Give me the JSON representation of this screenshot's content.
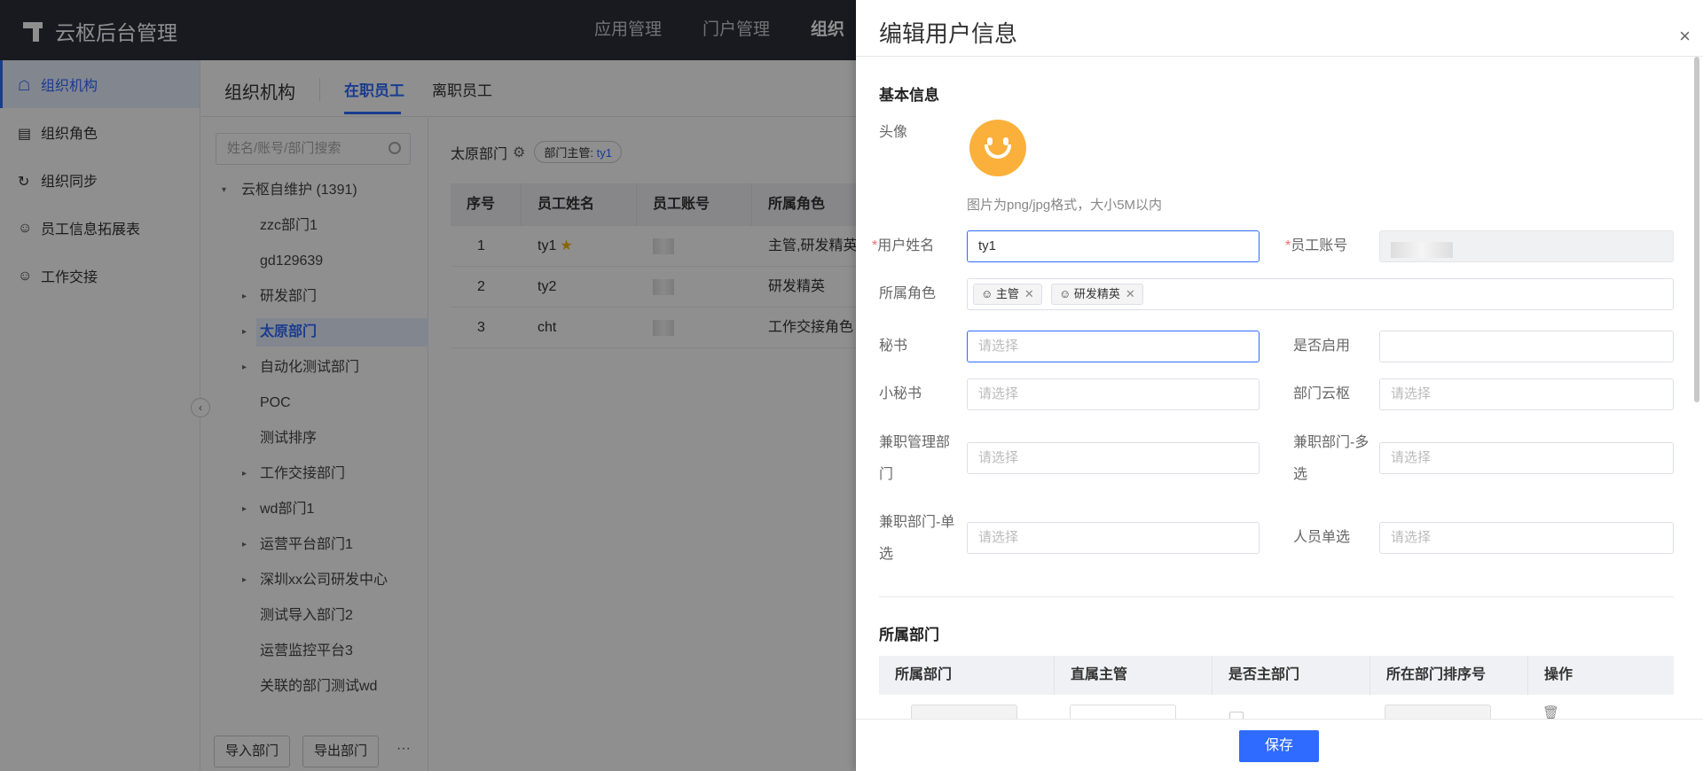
{
  "app": {
    "title": "云枢后台管理"
  },
  "topnav": {
    "items": [
      "应用管理",
      "门户管理",
      "组织"
    ]
  },
  "sidebar": {
    "items": [
      "组织机构",
      "组织角色",
      "组织同步",
      "员工信息拓展表",
      "工作交接"
    ]
  },
  "content": {
    "title": "组织机构",
    "tabs": [
      "在职员工",
      "离职员工"
    ]
  },
  "tree": {
    "search_placeholder": "姓名/账号/部门搜索",
    "root": "云枢自维护 (1391)",
    "nodes": [
      "zzc部门1",
      "gd129639",
      "研发部门",
      "太原部门",
      "自动化测试部门",
      "POC",
      "测试排序",
      "工作交接部门",
      "wd部门1",
      "运营平台部门1",
      "深圳xx公司研发中心",
      "测试导入部门2",
      "运营监控平台3",
      "关联的部门测试wd"
    ],
    "import_btn": "导入部门",
    "export_btn": "导出部门",
    "more": "···"
  },
  "employees": {
    "dept": "太原部门",
    "manager_label": "部门主管:",
    "manager_name": "ty1",
    "headers": [
      "序号",
      "员工姓名",
      "员工账号",
      "所属角色"
    ],
    "rows": [
      {
        "no": "1",
        "name": "ty1",
        "role": "主管,研发精英"
      },
      {
        "no": "2",
        "name": "ty2",
        "role": "研发精英"
      },
      {
        "no": "3",
        "name": "cht",
        "role": "工作交接角色"
      }
    ]
  },
  "drawer": {
    "title": "编辑用户信息",
    "close": "×",
    "basic_section": "基本信息",
    "avatar_label": "头像",
    "avatar_hint": "图片为png/jpg格式，大小5M以内",
    "name_label": "用户姓名",
    "name_value": "ty1",
    "account_label": "员工账号",
    "roles_label": "所属角色",
    "roles": [
      "主管",
      "研发精英"
    ],
    "secretary_label": "秘书",
    "enabled_label": "是否启用",
    "small_secretary_label": "小秘书",
    "dept_yunshu_label": "部门云枢",
    "parttime_mgr_label": "兼职管理部门",
    "parttime_multi_label": "兼职部门-多选",
    "parttime_single_label": "兼职部门-单选",
    "person_single_label": "人员单选",
    "placeholder": "请选择",
    "dept_section": "所属部门",
    "dept_headers": [
      "所属部门",
      "直属主管",
      "是否主部门",
      "所在部门排序号",
      "操作"
    ],
    "save": "保存"
  }
}
